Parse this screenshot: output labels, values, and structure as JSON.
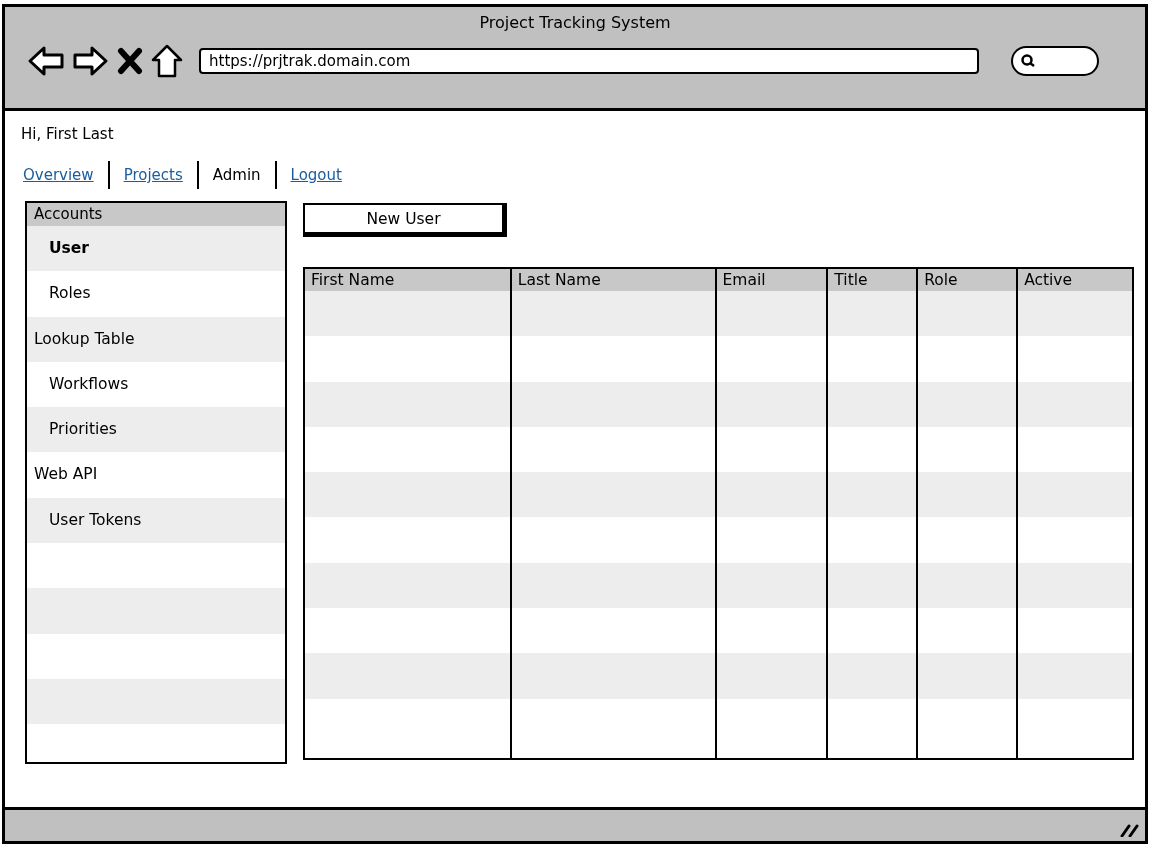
{
  "window": {
    "title": "Project Tracking System",
    "url": "https://prjtrak.domain.com"
  },
  "greeting": "Hi, First Last",
  "nav": [
    {
      "label": "Overview",
      "selected": false
    },
    {
      "label": "Projects",
      "selected": false
    },
    {
      "label": "Admin",
      "selected": true
    },
    {
      "label": "Logout",
      "selected": false
    }
  ],
  "sidebar": {
    "header": "Accounts",
    "items": [
      {
        "label": "User",
        "kind": "item",
        "selected": true
      },
      {
        "label": "Roles",
        "kind": "item",
        "selected": false
      },
      {
        "label": "Lookup Table",
        "kind": "group",
        "selected": false
      },
      {
        "label": "Workflows",
        "kind": "item",
        "selected": false
      },
      {
        "label": "Priorities",
        "kind": "item",
        "selected": false
      },
      {
        "label": "Web API",
        "kind": "group",
        "selected": false
      },
      {
        "label": "User Tokens",
        "kind": "item",
        "selected": false
      }
    ]
  },
  "new_button": "New User",
  "table": {
    "columns": [
      "First Name",
      "Last Name",
      "Email",
      "Title",
      "Role",
      "Active"
    ]
  }
}
